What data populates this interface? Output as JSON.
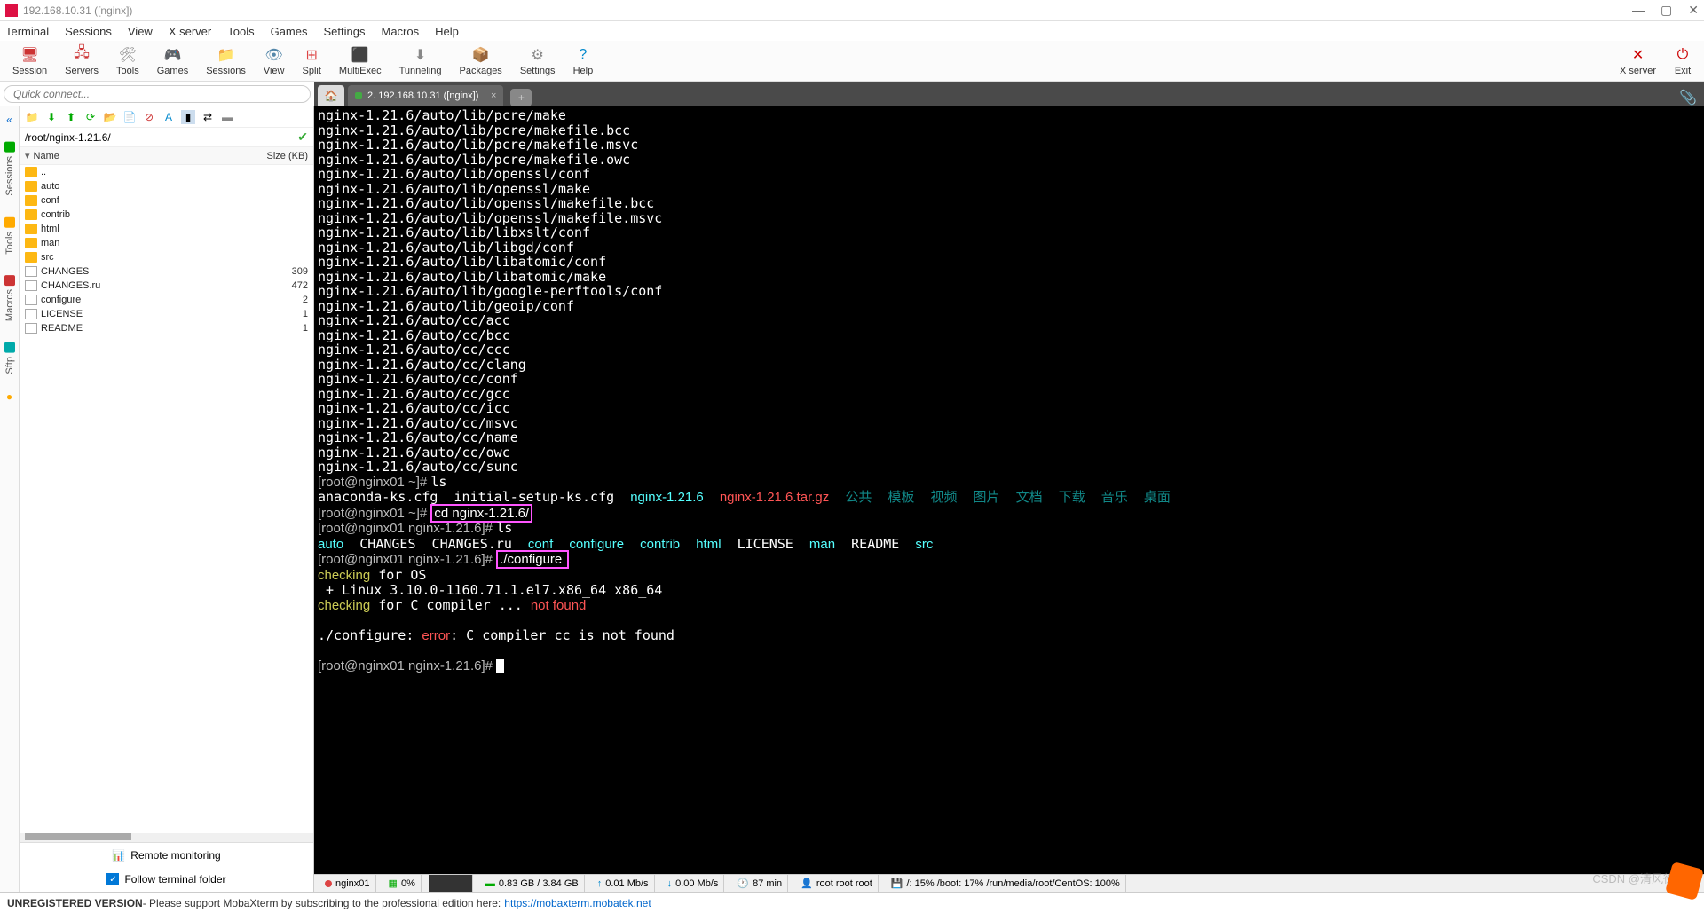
{
  "window": {
    "title": "192.168.10.31 ([nginx])"
  },
  "menubar": [
    "Terminal",
    "Sessions",
    "View",
    "X server",
    "Tools",
    "Games",
    "Settings",
    "Macros",
    "Help"
  ],
  "toolbar": [
    {
      "label": "Session",
      "icon": "🖥",
      "color": "#c33"
    },
    {
      "label": "Servers",
      "icon": "🖧",
      "color": "#c33"
    },
    {
      "label": "Tools",
      "icon": "🛠",
      "color": "#888"
    },
    {
      "label": "Games",
      "icon": "🎮",
      "color": "#c84"
    },
    {
      "label": "Sessions",
      "icon": "📁",
      "color": "#c84"
    },
    {
      "label": "View",
      "icon": "👁",
      "color": "#58a"
    },
    {
      "label": "Split",
      "icon": "⊞",
      "color": "#d44"
    },
    {
      "label": "MultiExec",
      "icon": "⬛",
      "color": "#58a"
    },
    {
      "label": "Tunneling",
      "icon": "⬇",
      "color": "#888"
    },
    {
      "label": "Packages",
      "icon": "📦",
      "color": "#c84"
    },
    {
      "label": "Settings",
      "icon": "⚙",
      "color": "#888"
    },
    {
      "label": "Help",
      "icon": "?",
      "color": "#08c"
    }
  ],
  "toolbar_right": [
    {
      "label": "X server",
      "icon": "✕",
      "color": "#c00"
    },
    {
      "label": "Exit",
      "icon": "⏻",
      "color": "#c00"
    }
  ],
  "quickconnect": {
    "placeholder": "Quick connect..."
  },
  "tab": {
    "label": "2. 192.168.10.31 ([nginx])"
  },
  "siderail": [
    {
      "label": "Sessions",
      "color": "#0a0"
    },
    {
      "label": "Tools",
      "color": "#fa0"
    },
    {
      "label": "Macros",
      "color": "#c33"
    },
    {
      "label": "Sftp",
      "color": "#0aa"
    }
  ],
  "sidebar": {
    "path": "/root/nginx-1.21.6/",
    "cols": {
      "name": "Name",
      "size": "Size (KB)"
    },
    "files": [
      {
        "name": "..",
        "type": "up",
        "size": ""
      },
      {
        "name": "auto",
        "type": "folder",
        "size": ""
      },
      {
        "name": "conf",
        "type": "folder",
        "size": ""
      },
      {
        "name": "contrib",
        "type": "folder",
        "size": ""
      },
      {
        "name": "html",
        "type": "folder",
        "size": ""
      },
      {
        "name": "man",
        "type": "folder",
        "size": ""
      },
      {
        "name": "src",
        "type": "folder",
        "size": ""
      },
      {
        "name": "CHANGES",
        "type": "file",
        "size": "309"
      },
      {
        "name": "CHANGES.ru",
        "type": "file",
        "size": "472"
      },
      {
        "name": "configure",
        "type": "file",
        "size": "2"
      },
      {
        "name": "LICENSE",
        "type": "file",
        "size": "1"
      },
      {
        "name": "README",
        "type": "file",
        "size": "1"
      }
    ],
    "remote": "Remote monitoring",
    "follow": "Follow terminal folder"
  },
  "terminal": {
    "paths": [
      "nginx-1.21.6/auto/lib/pcre/make",
      "nginx-1.21.6/auto/lib/pcre/makefile.bcc",
      "nginx-1.21.6/auto/lib/pcre/makefile.msvc",
      "nginx-1.21.6/auto/lib/pcre/makefile.owc",
      "nginx-1.21.6/auto/lib/openssl/conf",
      "nginx-1.21.6/auto/lib/openssl/make",
      "nginx-1.21.6/auto/lib/openssl/makefile.bcc",
      "nginx-1.21.6/auto/lib/openssl/makefile.msvc",
      "nginx-1.21.6/auto/lib/libxslt/conf",
      "nginx-1.21.6/auto/lib/libgd/conf",
      "nginx-1.21.6/auto/lib/libatomic/conf",
      "nginx-1.21.6/auto/lib/libatomic/make",
      "nginx-1.21.6/auto/lib/google-perftools/conf",
      "nginx-1.21.6/auto/lib/geoip/conf",
      "nginx-1.21.6/auto/cc/acc",
      "nginx-1.21.6/auto/cc/bcc",
      "nginx-1.21.6/auto/cc/ccc",
      "nginx-1.21.6/auto/cc/clang",
      "nginx-1.21.6/auto/cc/conf",
      "nginx-1.21.6/auto/cc/gcc",
      "nginx-1.21.6/auto/cc/icc",
      "nginx-1.21.6/auto/cc/msvc",
      "nginx-1.21.6/auto/cc/name",
      "nginx-1.21.6/auto/cc/owc",
      "nginx-1.21.6/auto/cc/sunc"
    ],
    "prompt1": "[root@nginx01 ~]# ",
    "cmd_ls": "ls",
    "ls_line1_a": "anaconda-ks.cfg  initial-setup-ks.cfg  ",
    "ls_nginx": "nginx-1.21.6",
    "ls_tar": "nginx-1.21.6.tar.gz",
    "ls_cn": [
      "公共",
      "模板",
      "视频",
      "图片",
      "文档",
      "下载",
      "音乐",
      "桌面"
    ],
    "cmd_cd": "cd nginx-1.21.6/",
    "prompt2": "[root@nginx01 nginx-1.21.6]# ",
    "ls2": {
      "auto": "auto",
      "changes": "CHANGES",
      "changesru": "CHANGES.ru",
      "conf": "conf",
      "configure": "configure",
      "contrib": "contrib",
      "html": "html",
      "license": "LICENSE",
      "man": "man",
      "readme": "README",
      "src": "src"
    },
    "cmd_conf": "./configure",
    "checking1": "checking",
    "for_os": " for OS",
    "linux": " + Linux 3.10.0-1160.71.1.el7.x86_64 x86_64",
    "checking2": "checking",
    "for_c": " for C compiler ... ",
    "notfound": "not found",
    "err_pre": "./configure: ",
    "err": "error",
    "err_post": ": C compiler cc is not found"
  },
  "status": {
    "host": "nginx01",
    "cpu": "0%",
    "mem": "0.83 GB / 3.84 GB",
    "up": "0.01 Mb/s",
    "down": "0.00 Mb/s",
    "time": "87 min",
    "user": "root root root",
    "disks": "/: 15%   /boot: 17%   /run/media/root/CentOS: 100%"
  },
  "footer": {
    "unreg": "UNREGISTERED VERSION",
    "msg": " -  Please support MobaXterm by subscribing to the professional edition here:",
    "url": "https://mobaxterm.mobatek.net"
  },
  "watermark": "CSDN @清风徐来"
}
